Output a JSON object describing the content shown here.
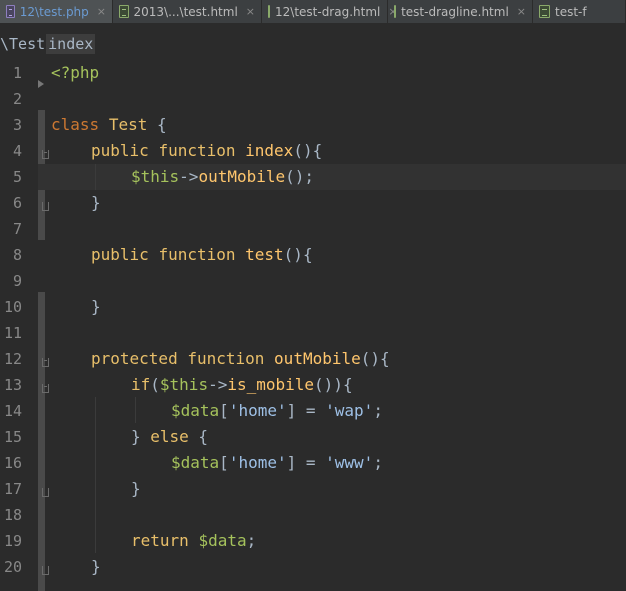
{
  "tabs": [
    {
      "label": "12\\test.php",
      "icon": "php-file-icon",
      "active": true
    },
    {
      "label": "2013\\...\\test.html",
      "icon": "html-file-icon",
      "active": false
    },
    {
      "label": "12\\test-drag.html",
      "icon": "html-file-icon",
      "active": false
    },
    {
      "label": "test-dragline.html",
      "icon": "html-file-icon",
      "active": false
    },
    {
      "label": "test-f",
      "icon": "html-file-icon",
      "active": false
    }
  ],
  "close_glyph": "×",
  "breadcrumb": {
    "class": "\\Test",
    "method": "index"
  },
  "line_numbers": [
    "1",
    "2",
    "3",
    "4",
    "5",
    "6",
    "7",
    "8",
    "9",
    "10",
    "11",
    "12",
    "13",
    "14",
    "15",
    "16",
    "17",
    "18",
    "19",
    "20"
  ],
  "code": {
    "l1": {
      "open": "<?php"
    },
    "l3": {
      "kw": "class",
      "name": "Test",
      "brace": "{"
    },
    "l4": {
      "kw1": "public",
      "kw2": "function",
      "name": "index",
      "rest": "(){"
    },
    "l5": {
      "var": "$this",
      "arrow": "->",
      "call": "outMobile",
      "rest": "();"
    },
    "l6": {
      "brace": "}"
    },
    "l8": {
      "kw1": "public",
      "kw2": "function",
      "name": "test",
      "rest": "(){"
    },
    "l10": {
      "brace": "}"
    },
    "l12": {
      "kw1": "protected",
      "kw2": "function",
      "name": "outMobile",
      "rest": "(){"
    },
    "l13": {
      "kw": "if",
      "paren": "(",
      "var": "$this",
      "arrow": "->",
      "call": "is_mobile",
      "rest": "()){"
    },
    "l14": {
      "var": "$data",
      "open": "[",
      "key": "'home'",
      "mid": "] = ",
      "val": "'wap'",
      "end": ";"
    },
    "l15": {
      "pre": "} ",
      "kw": "else",
      "post": " {"
    },
    "l16": {
      "var": "$data",
      "open": "[",
      "key": "'home'",
      "mid": "] = ",
      "val": "'www'",
      "end": ";"
    },
    "l17": {
      "brace": "}"
    },
    "l19": {
      "kw": "return",
      "var": "$data",
      "end": ";"
    },
    "l20": {
      "brace": "}"
    }
  },
  "colors": {
    "background": "#2b2b2b",
    "keyword": "#cc7832",
    "function": "#ffc66d",
    "variable": "#9876aa",
    "string": "#6a8759",
    "active_tab_text": "#6b9bd2"
  }
}
